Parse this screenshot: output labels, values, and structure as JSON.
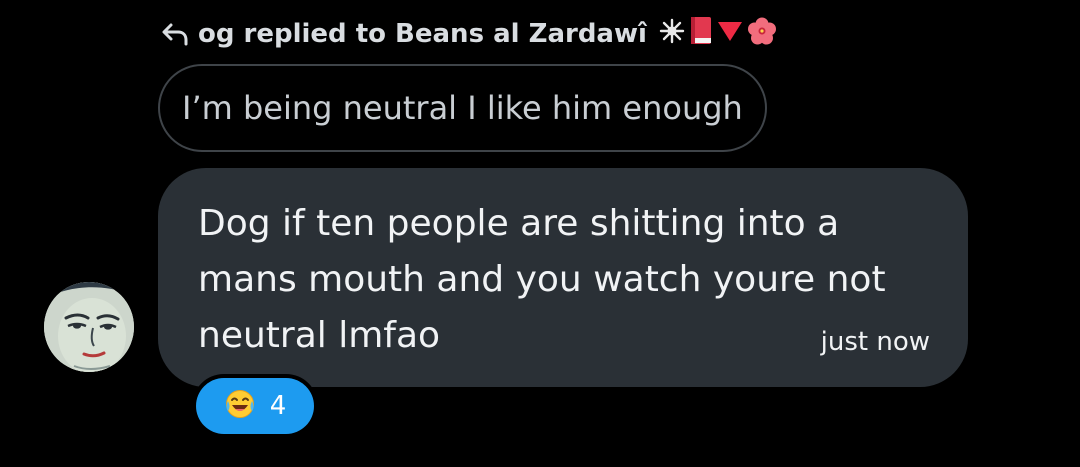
{
  "reply": {
    "text": "og replied to Beans al Zardawî",
    "emojis": [
      "sparkle-icon",
      "red-book-icon",
      "red-triangle-icon",
      "hibiscus-icon"
    ]
  },
  "quoted_message": {
    "text": "I’m being neutral I like him enough"
  },
  "message": {
    "text": "Dog if ten people are shitting into a mans mouth and you watch youre not neutral lmfao",
    "timestamp": "just now"
  },
  "reaction": {
    "emoji": "laughing-tears-icon",
    "count": "4"
  },
  "colors": {
    "background": "#000000",
    "bubble": "#2a3036",
    "reaction_pill": "#1d9bf0"
  }
}
